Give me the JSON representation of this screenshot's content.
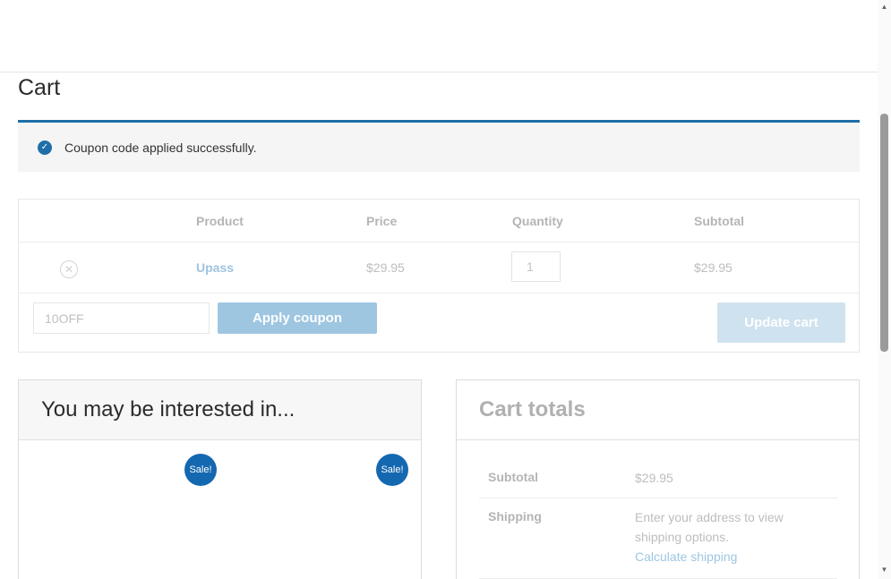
{
  "page": {
    "title": "Cart"
  },
  "notice": {
    "message": "Coupon code applied successfully.",
    "icon": "check-circle-icon",
    "accent_color": "#1e6fa8"
  },
  "table": {
    "headers": {
      "product": "Product",
      "price": "Price",
      "quantity": "Quantity",
      "subtotal": "Subtotal"
    },
    "items": [
      {
        "name": "Upass",
        "price": "$29.95",
        "quantity": "1",
        "subtotal": "$29.95"
      }
    ],
    "coupon_value": "10OFF",
    "apply_coupon_label": "Apply coupon",
    "update_cart_label": "Update cart"
  },
  "cross_sells": {
    "title": "You may be interested in...",
    "badges": [
      "Sale!",
      "Sale!"
    ]
  },
  "totals": {
    "title": "Cart totals",
    "subtotal_label": "Subtotal",
    "subtotal_value": "$29.95",
    "shipping_label": "Shipping",
    "shipping_text": "Enter your address to view shipping options.",
    "calculate_link": "Calculate shipping"
  }
}
